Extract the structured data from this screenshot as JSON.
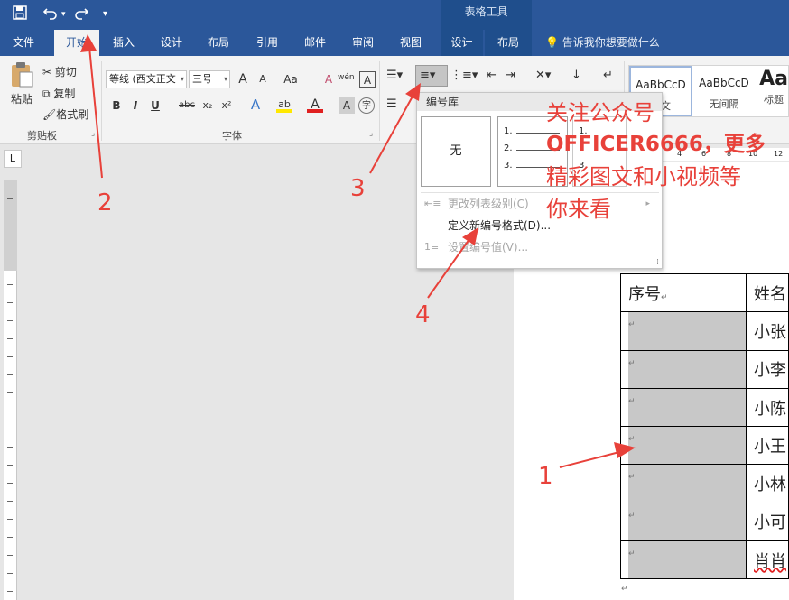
{
  "titlebar": {
    "save_icon": "save-icon",
    "undo_icon": "undo-icon",
    "redo_icon": "redo-icon",
    "customize_icon": "customize-qat-icon",
    "context_group": "表格工具"
  },
  "tabs": {
    "file": "文件",
    "home": "开始",
    "insert": "插入",
    "design": "设计",
    "layout": "布局",
    "references": "引用",
    "mailings": "邮件",
    "review": "审阅",
    "view": "视图",
    "table_design": "设计",
    "table_layout": "布局",
    "tell_me": "告诉我你想要做什么"
  },
  "clipboard": {
    "paste": "粘贴",
    "cut": "剪切",
    "copy": "复制",
    "format_painter": "格式刷",
    "group_label": "剪贴板"
  },
  "font": {
    "name": "等线 (西文正文",
    "size": "三号",
    "grow": "A",
    "shrink": "A",
    "case": "Aa",
    "clear": "A",
    "phonetic": "wén",
    "border": "A",
    "bold": "B",
    "italic": "I",
    "underline": "U",
    "strike": "abc",
    "sub": "x₂",
    "sup": "x²",
    "effects": "A",
    "highlight": "ab",
    "color": "A",
    "shade": "A",
    "enclose": "字",
    "group_label": "字体"
  },
  "styles": {
    "items": [
      {
        "sample": "AaBbCcD",
        "name": "正文"
      },
      {
        "sample": "AaBbCcD",
        "name": "无间隔"
      },
      {
        "sample": "Aa",
        "name": "标题"
      }
    ]
  },
  "dropdown": {
    "header": "编号库",
    "none_label": "无",
    "list_preview": [
      "1.",
      "2.",
      "3."
    ],
    "items": [
      {
        "label": "更改列表级别(C)",
        "enabled": false
      },
      {
        "label": "定义新编号格式(D)...",
        "enabled": true
      },
      {
        "label": "设置编号值(V)...",
        "enabled": false
      }
    ]
  },
  "ruler": {
    "corner": "L",
    "numbers": [
      "4",
      "6",
      "8",
      "10",
      "12"
    ]
  },
  "table": {
    "headers": [
      "序号",
      "姓名"
    ],
    "names": [
      "小张",
      "小李",
      "小陈",
      "小王",
      "小林",
      "小可",
      "肖肖"
    ]
  },
  "annotations": {
    "numbers": [
      "1",
      "2",
      "3",
      "4"
    ],
    "promo_lines": [
      "关注公众号",
      "OFFICER6666，更多",
      "精彩图文和小视频等",
      "你来看"
    ],
    "color": "#e8413a"
  },
  "colors": {
    "accent": "#2b579a",
    "ribbon": "#f3f3f3"
  }
}
